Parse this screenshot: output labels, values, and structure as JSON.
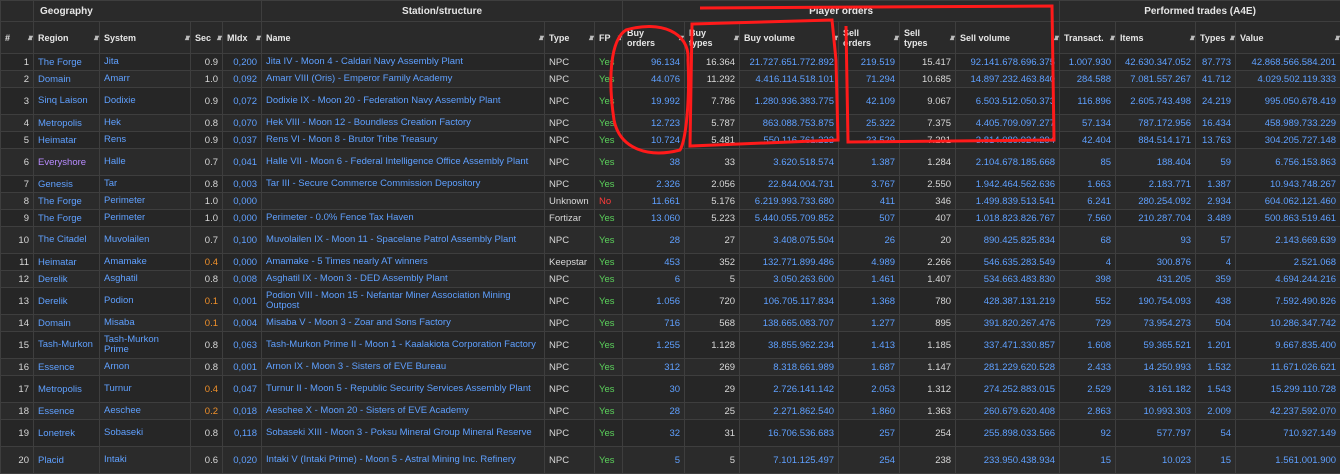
{
  "header_groups": {
    "geography": "Geography",
    "station": "Station/structure",
    "player_orders": "Player orders",
    "performed_trades": "Performed trades (A4E)"
  },
  "columns": {
    "idx": "#",
    "region": "Region",
    "system": "System",
    "sec": "Sec",
    "midx": "MIdx",
    "name": "Name",
    "type": "Type",
    "fp": "FP",
    "buy_orders": "Buy orders",
    "buy_types": "Buy types",
    "buy_volume": "Buy volume",
    "sell_orders": "Sell orders",
    "sell_types": "Sell types",
    "sell_volume": "Sell volume",
    "transact": "Transact.",
    "items": "Items",
    "types": "Types",
    "value": "Value"
  },
  "sort_icon": "sort-arrows-icon",
  "annotation_color": "#ff1a1a",
  "rows": [
    {
      "idx": "1",
      "region": "The Forge",
      "system": "Jita",
      "sec": "0.9",
      "midx": "0,200",
      "name": "Jita IV - Moon 4 - Caldari Navy Assembly Plant",
      "type": "NPC",
      "fp": "Yes",
      "bo": "96.134",
      "bt": "16.364",
      "bv": "21.727.651.772.892",
      "so": "219.519",
      "st": "15.417",
      "sv": "92.141.678.696.375",
      "tr": "1.007.930",
      "it": "42.630.347.052",
      "ty": "87.773",
      "va": "42.868.566.584.201"
    },
    {
      "idx": "2",
      "region": "Domain",
      "system": "Amarr",
      "sec": "1.0",
      "midx": "0,092",
      "name": "Amarr VIII (Oris) - Emperor Family Academy",
      "type": "NPC",
      "fp": "Yes",
      "bo": "44.076",
      "bt": "11.292",
      "bv": "4.416.114.518.101",
      "so": "71.294",
      "st": "10.685",
      "sv": "14.897.232.463.840",
      "tr": "284.588",
      "it": "7.081.557.267",
      "ty": "41.712",
      "va": "4.029.502.119.333"
    },
    {
      "idx": "3",
      "region": "Sinq Laison",
      "system": "Dodixie",
      "sec": "0.9",
      "midx": "0,072",
      "name": "Dodixie IX - Moon 20 - Federation Navy Assembly Plant",
      "type": "NPC",
      "fp": "Yes",
      "bo": "19.992",
      "bt": "7.786",
      "bv": "1.280.936.383.775",
      "so": "42.109",
      "st": "9.067",
      "sv": "6.503.512.050.373",
      "tr": "116.896",
      "it": "2.605.743.498",
      "ty": "24.219",
      "va": "995.050.678.419"
    },
    {
      "idx": "4",
      "region": "Metropolis",
      "system": "Hek",
      "sec": "0.8",
      "midx": "0,070",
      "name": "Hek VIII - Moon 12 - Boundless Creation Factory",
      "type": "NPC",
      "fp": "Yes",
      "bo": "12.723",
      "bt": "5.787",
      "bv": "863.088.753.875",
      "so": "25.322",
      "st": "7.375",
      "sv": "4.405.709.097.277",
      "tr": "57.134",
      "it": "787.172.956",
      "ty": "16.434",
      "va": "458.989.733.229"
    },
    {
      "idx": "5",
      "region": "Heimatar",
      "system": "Rens",
      "sec": "0.9",
      "midx": "0,037",
      "name": "Rens VI - Moon 8 - Brutor Tribe Treasury",
      "type": "NPC",
      "fp": "Yes",
      "bo": "10.724",
      "bt": "5.481",
      "bv": "550.116.761.233",
      "so": "23.529",
      "st": "7.291",
      "sv": "3.814.089.924.294",
      "tr": "42.404",
      "it": "884.514.171",
      "ty": "13.763",
      "va": "304.205.727.148"
    },
    {
      "idx": "6",
      "region": "Everyshore",
      "system": "Halle",
      "sec": "0.7",
      "midx": "0,041",
      "name": "Halle VII - Moon 6 - Federal Intelligence Office Assembly Plant",
      "type": "NPC",
      "fp": "Yes",
      "bo": "38",
      "bt": "33",
      "bv": "3.620.518.574",
      "so": "1.387",
      "st": "1.284",
      "sv": "2.104.678.185.668",
      "tr": "85",
      "it": "188.404",
      "ty": "59",
      "va": "6.756.153.863"
    },
    {
      "idx": "7",
      "region": "Genesis",
      "system": "Tar",
      "sec": "0.8",
      "midx": "0,003",
      "name": "Tar III - Secure Commerce Commission Depository",
      "type": "NPC",
      "fp": "Yes",
      "bo": "2.326",
      "bt": "2.056",
      "bv": "22.844.004.731",
      "so": "3.767",
      "st": "2.550",
      "sv": "1.942.464.562.636",
      "tr": "1.663",
      "it": "2.183.771",
      "ty": "1.387",
      "va": "10.943.748.267"
    },
    {
      "idx": "8",
      "region": "The Forge",
      "system": "Perimeter",
      "sec": "1.0",
      "midx": "0,000",
      "name": "",
      "type": "Unknown",
      "fp": "No",
      "bo": "11.661",
      "bt": "5.176",
      "bv": "6.219.993.733.680",
      "so": "411",
      "st": "346",
      "sv": "1.499.839.513.541",
      "tr": "6.241",
      "it": "280.254.092",
      "ty": "2.934",
      "va": "604.062.121.460"
    },
    {
      "idx": "9",
      "region": "The Forge",
      "system": "Perimeter",
      "sec": "1.0",
      "midx": "0,000",
      "name": "Perimeter - 0.0% Fence Tax Haven",
      "type": "Fortizar",
      "fp": "Yes",
      "bo": "13.060",
      "bt": "5.223",
      "bv": "5.440.055.709.852",
      "so": "507",
      "st": "407",
      "sv": "1.018.823.826.767",
      "tr": "7.560",
      "it": "210.287.704",
      "ty": "3.489",
      "va": "500.863.519.461"
    },
    {
      "idx": "10",
      "region": "The Citadel",
      "system": "Muvolailen",
      "sec": "0.7",
      "midx": "0,100",
      "name": "Muvolailen IX - Moon 11 - Spacelane Patrol Assembly Plant",
      "type": "NPC",
      "fp": "Yes",
      "bo": "28",
      "bt": "27",
      "bv": "3.408.075.504",
      "so": "26",
      "st": "20",
      "sv": "890.425.825.834",
      "tr": "68",
      "it": "93",
      "ty": "57",
      "va": "2.143.669.639"
    },
    {
      "idx": "11",
      "region": "Heimatar",
      "system": "Amamake",
      "sec": "0.4",
      "midx": "0,000",
      "name": "Amamake - 5 Times nearly AT winners",
      "type": "Keepstar",
      "fp": "Yes",
      "bo": "453",
      "bt": "352",
      "bv": "132.771.899.486",
      "so": "4.989",
      "st": "2.266",
      "sv": "546.635.283.549",
      "tr": "4",
      "it": "300.876",
      "ty": "4",
      "va": "2.521.068"
    },
    {
      "idx": "12",
      "region": "Derelik",
      "system": "Asghatil",
      "sec": "0.8",
      "midx": "0,008",
      "name": "Asghatil IX - Moon 3 - DED Assembly Plant",
      "type": "NPC",
      "fp": "Yes",
      "bo": "6",
      "bt": "5",
      "bv": "3.050.263.600",
      "so": "1.461",
      "st": "1.407",
      "sv": "534.663.483.830",
      "tr": "398",
      "it": "431.205",
      "ty": "359",
      "va": "4.694.244.216"
    },
    {
      "idx": "13",
      "region": "Derelik",
      "system": "Podion",
      "sec": "0.1",
      "midx": "0,001",
      "name": "Podion VIII - Moon 15 - Nefantar Miner Association Mining Outpost",
      "type": "NPC",
      "fp": "Yes",
      "bo": "1.056",
      "bt": "720",
      "bv": "106.705.117.834",
      "so": "1.368",
      "st": "780",
      "sv": "428.387.131.219",
      "tr": "552",
      "it": "190.754.093",
      "ty": "438",
      "va": "7.592.490.826"
    },
    {
      "idx": "14",
      "region": "Domain",
      "system": "Misaba",
      "sec": "0.1",
      "midx": "0,004",
      "name": "Misaba V - Moon 3 - Zoar and Sons Factory",
      "type": "NPC",
      "fp": "Yes",
      "bo": "716",
      "bt": "568",
      "bv": "138.665.083.707",
      "so": "1.277",
      "st": "895",
      "sv": "391.820.267.476",
      "tr": "729",
      "it": "73.954.273",
      "ty": "504",
      "va": "10.286.347.742"
    },
    {
      "idx": "15",
      "region": "Tash-Murkon",
      "system": "Tash-Murkon Prime",
      "sec": "0.8",
      "midx": "0,063",
      "name": "Tash-Murkon Prime II - Moon 1 - Kaalakiota Corporation Factory",
      "type": "NPC",
      "fp": "Yes",
      "bo": "1.255",
      "bt": "1.128",
      "bv": "38.855.962.234",
      "so": "1.413",
      "st": "1.185",
      "sv": "337.471.330.857",
      "tr": "1.608",
      "it": "59.365.521",
      "ty": "1.201",
      "va": "9.667.835.400"
    },
    {
      "idx": "16",
      "region": "Essence",
      "system": "Arnon",
      "sec": "0.8",
      "midx": "0,001",
      "name": "Arnon IX - Moon 3 - Sisters of EVE Bureau",
      "type": "NPC",
      "fp": "Yes",
      "bo": "312",
      "bt": "269",
      "bv": "8.318.661.989",
      "so": "1.687",
      "st": "1.147",
      "sv": "281.229.620.528",
      "tr": "2.433",
      "it": "14.250.993",
      "ty": "1.532",
      "va": "11.671.026.621"
    },
    {
      "idx": "17",
      "region": "Metropolis",
      "system": "Turnur",
      "sec": "0.4",
      "midx": "0,047",
      "name": "Turnur II - Moon 5 - Republic Security Services Assembly Plant",
      "type": "NPC",
      "fp": "Yes",
      "bo": "30",
      "bt": "29",
      "bv": "2.726.141.142",
      "so": "2.053",
      "st": "1.312",
      "sv": "274.252.883.015",
      "tr": "2.529",
      "it": "3.161.182",
      "ty": "1.543",
      "va": "15.299.110.728"
    },
    {
      "idx": "18",
      "region": "Essence",
      "system": "Aeschee",
      "sec": "0.2",
      "midx": "0,018",
      "name": "Aeschee X - Moon 20 - Sisters of EVE Academy",
      "type": "NPC",
      "fp": "Yes",
      "bo": "28",
      "bt": "25",
      "bv": "2.271.862.540",
      "so": "1.860",
      "st": "1.363",
      "sv": "260.679.620.408",
      "tr": "2.863",
      "it": "10.993.303",
      "ty": "2.009",
      "va": "42.237.592.070"
    },
    {
      "idx": "19",
      "region": "Lonetrek",
      "system": "Sobaseki",
      "sec": "0.8",
      "midx": "0,118",
      "name": "Sobaseki XIII - Moon 3 - Poksu Mineral Group Mineral Reserve",
      "type": "NPC",
      "fp": "Yes",
      "bo": "32",
      "bt": "31",
      "bv": "16.706.536.683",
      "so": "257",
      "st": "254",
      "sv": "255.898.033.566",
      "tr": "92",
      "it": "577.797",
      "ty": "54",
      "va": "710.927.149"
    },
    {
      "idx": "20",
      "region": "Placid",
      "system": "Intaki",
      "sec": "0.6",
      "midx": "0,020",
      "name": "Intaki V (Intaki Prime) - Moon 5 - Astral Mining Inc. Refinery",
      "type": "NPC",
      "fp": "Yes",
      "bo": "5",
      "bt": "5",
      "bv": "7.101.125.497",
      "so": "254",
      "st": "238",
      "sv": "233.950.438.934",
      "tr": "15",
      "it": "10.023",
      "ty": "15",
      "va": "1.561.001.900"
    }
  ]
}
